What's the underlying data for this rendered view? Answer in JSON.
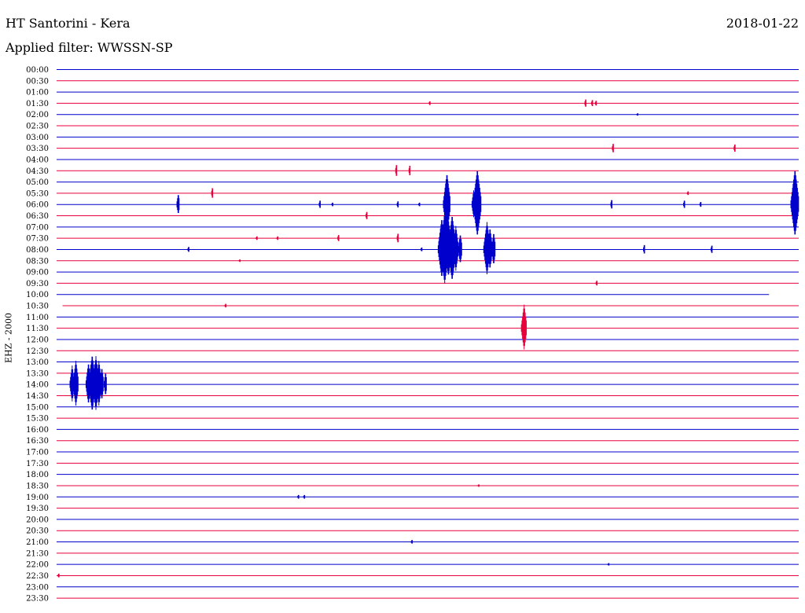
{
  "header": {
    "station": "HT Santorini - Kera",
    "date": "2018-01-22",
    "filter": "Applied filter: WWSSN-SP"
  },
  "chart_data": {
    "type": "line",
    "title": "HT Santorini - Kera",
    "date": "2018-01-22",
    "filter": "WWSSN-SP",
    "ylabel": "EHZ - 2000",
    "colors": {
      "odd_trace": "#0000cc",
      "even_trace": "#e8003c"
    },
    "rows": [
      "00:00",
      "00:30",
      "01:00",
      "01:30",
      "02:00",
      "02:30",
      "03:00",
      "03:30",
      "04:00",
      "04:30",
      "05:00",
      "05:30",
      "06:00",
      "06:30",
      "07:00",
      "07:30",
      "08:00",
      "08:30",
      "09:00",
      "09:30",
      "10:00",
      "10:30",
      "11:00",
      "11:30",
      "12:00",
      "12:30",
      "13:00",
      "13:30",
      "14:00",
      "14:30",
      "15:00",
      "15:30",
      "16:00",
      "16:30",
      "17:00",
      "17:30",
      "18:00",
      "18:30",
      "19:00",
      "19:30",
      "20:00",
      "20:30",
      "21:00",
      "21:30",
      "22:00",
      "22:30",
      "23:00",
      "23:30"
    ],
    "trace_extent": [
      0,
      1
    ],
    "partial_traces": [
      {
        "row": "10:00",
        "end": 0.96
      },
      {
        "row": "10:30",
        "start": 0.008
      }
    ],
    "events": [
      {
        "row": "01:30",
        "pos": 0.503,
        "amp": 3
      },
      {
        "row": "01:30",
        "pos": 0.713,
        "amp": 6
      },
      {
        "row": "01:30",
        "pos": 0.722,
        "amp": 5
      },
      {
        "row": "01:30",
        "pos": 0.727,
        "amp": 4
      },
      {
        "row": "02:00",
        "pos": 0.783,
        "amp": 2
      },
      {
        "row": "03:30",
        "pos": 0.75,
        "amp": 7
      },
      {
        "row": "03:30",
        "pos": 0.914,
        "amp": 6
      },
      {
        "row": "04:30",
        "pos": 0.458,
        "amp": 9
      },
      {
        "row": "04:30",
        "pos": 0.476,
        "amp": 8
      },
      {
        "row": "05:30",
        "pos": 0.21,
        "amp": 8
      },
      {
        "row": "05:30",
        "pos": 0.851,
        "amp": 3
      },
      {
        "row": "06:00",
        "pos": 0.164,
        "amp": 14
      },
      {
        "row": "06:00",
        "pos": 0.355,
        "amp": 6
      },
      {
        "row": "06:00",
        "pos": 0.372,
        "amp": 3
      },
      {
        "row": "06:00",
        "pos": 0.46,
        "amp": 5
      },
      {
        "row": "06:00",
        "pos": 0.489,
        "amp": 3
      },
      {
        "row": "06:00",
        "pos": 0.748,
        "amp": 7
      },
      {
        "row": "06:00",
        "pos": 0.846,
        "amp": 6
      },
      {
        "row": "06:00",
        "pos": 0.868,
        "amp": 4
      },
      {
        "row": "06:00",
        "pos": 0.526,
        "amp": 40
      },
      {
        "row": "06:00",
        "pos": 0.567,
        "amp": 45
      },
      {
        "row": "06:00",
        "pos": 0.562,
        "amp": 18
      },
      {
        "row": "06:00",
        "pos": 0.995,
        "amp": 45
      },
      {
        "row": "06:30",
        "pos": 0.418,
        "amp": 6
      },
      {
        "row": "07:30",
        "pos": 0.27,
        "amp": 3
      },
      {
        "row": "07:30",
        "pos": 0.298,
        "amp": 3
      },
      {
        "row": "07:30",
        "pos": 0.38,
        "amp": 5
      },
      {
        "row": "07:30",
        "pos": 0.46,
        "amp": 7
      },
      {
        "row": "08:00",
        "pos": 0.178,
        "amp": 4
      },
      {
        "row": "08:00",
        "pos": 0.492,
        "amp": 3
      },
      {
        "row": "08:00",
        "pos": 0.519,
        "amp": 40
      },
      {
        "row": "08:00",
        "pos": 0.523,
        "amp": 48
      },
      {
        "row": "08:00",
        "pos": 0.528,
        "amp": 38
      },
      {
        "row": "08:00",
        "pos": 0.533,
        "amp": 44
      },
      {
        "row": "08:00",
        "pos": 0.538,
        "amp": 30
      },
      {
        "row": "08:00",
        "pos": 0.544,
        "amp": 20
      },
      {
        "row": "08:00",
        "pos": 0.58,
        "amp": 35
      },
      {
        "row": "08:00",
        "pos": 0.584,
        "amp": 28
      },
      {
        "row": "08:00",
        "pos": 0.589,
        "amp": 22
      },
      {
        "row": "08:00",
        "pos": 0.792,
        "amp": 7
      },
      {
        "row": "08:00",
        "pos": 0.883,
        "amp": 6
      },
      {
        "row": "08:30",
        "pos": 0.247,
        "amp": 2
      },
      {
        "row": "09:30",
        "pos": 0.728,
        "amp": 4
      },
      {
        "row": "10:30",
        "pos": 0.228,
        "amp": 3
      },
      {
        "row": "11:30",
        "pos": 0.63,
        "amp": 30
      },
      {
        "row": "14:00",
        "pos": 0.021,
        "amp": 24
      },
      {
        "row": "14:00",
        "pos": 0.026,
        "amp": 30
      },
      {
        "row": "14:00",
        "pos": 0.043,
        "amp": 28
      },
      {
        "row": "14:00",
        "pos": 0.048,
        "amp": 38
      },
      {
        "row": "14:00",
        "pos": 0.053,
        "amp": 36
      },
      {
        "row": "14:00",
        "pos": 0.057,
        "amp": 30
      },
      {
        "row": "14:00",
        "pos": 0.061,
        "amp": 22
      },
      {
        "row": "14:00",
        "pos": 0.066,
        "amp": 16
      },
      {
        "row": "18:30",
        "pos": 0.569,
        "amp": 2
      },
      {
        "row": "19:00",
        "pos": 0.326,
        "amp": 3
      },
      {
        "row": "19:00",
        "pos": 0.334,
        "amp": 3
      },
      {
        "row": "21:00",
        "pos": 0.479,
        "amp": 3
      },
      {
        "row": "22:30",
        "pos": 0.003,
        "amp": 3
      },
      {
        "row": "22:00",
        "pos": 0.744,
        "amp": 2
      }
    ]
  }
}
